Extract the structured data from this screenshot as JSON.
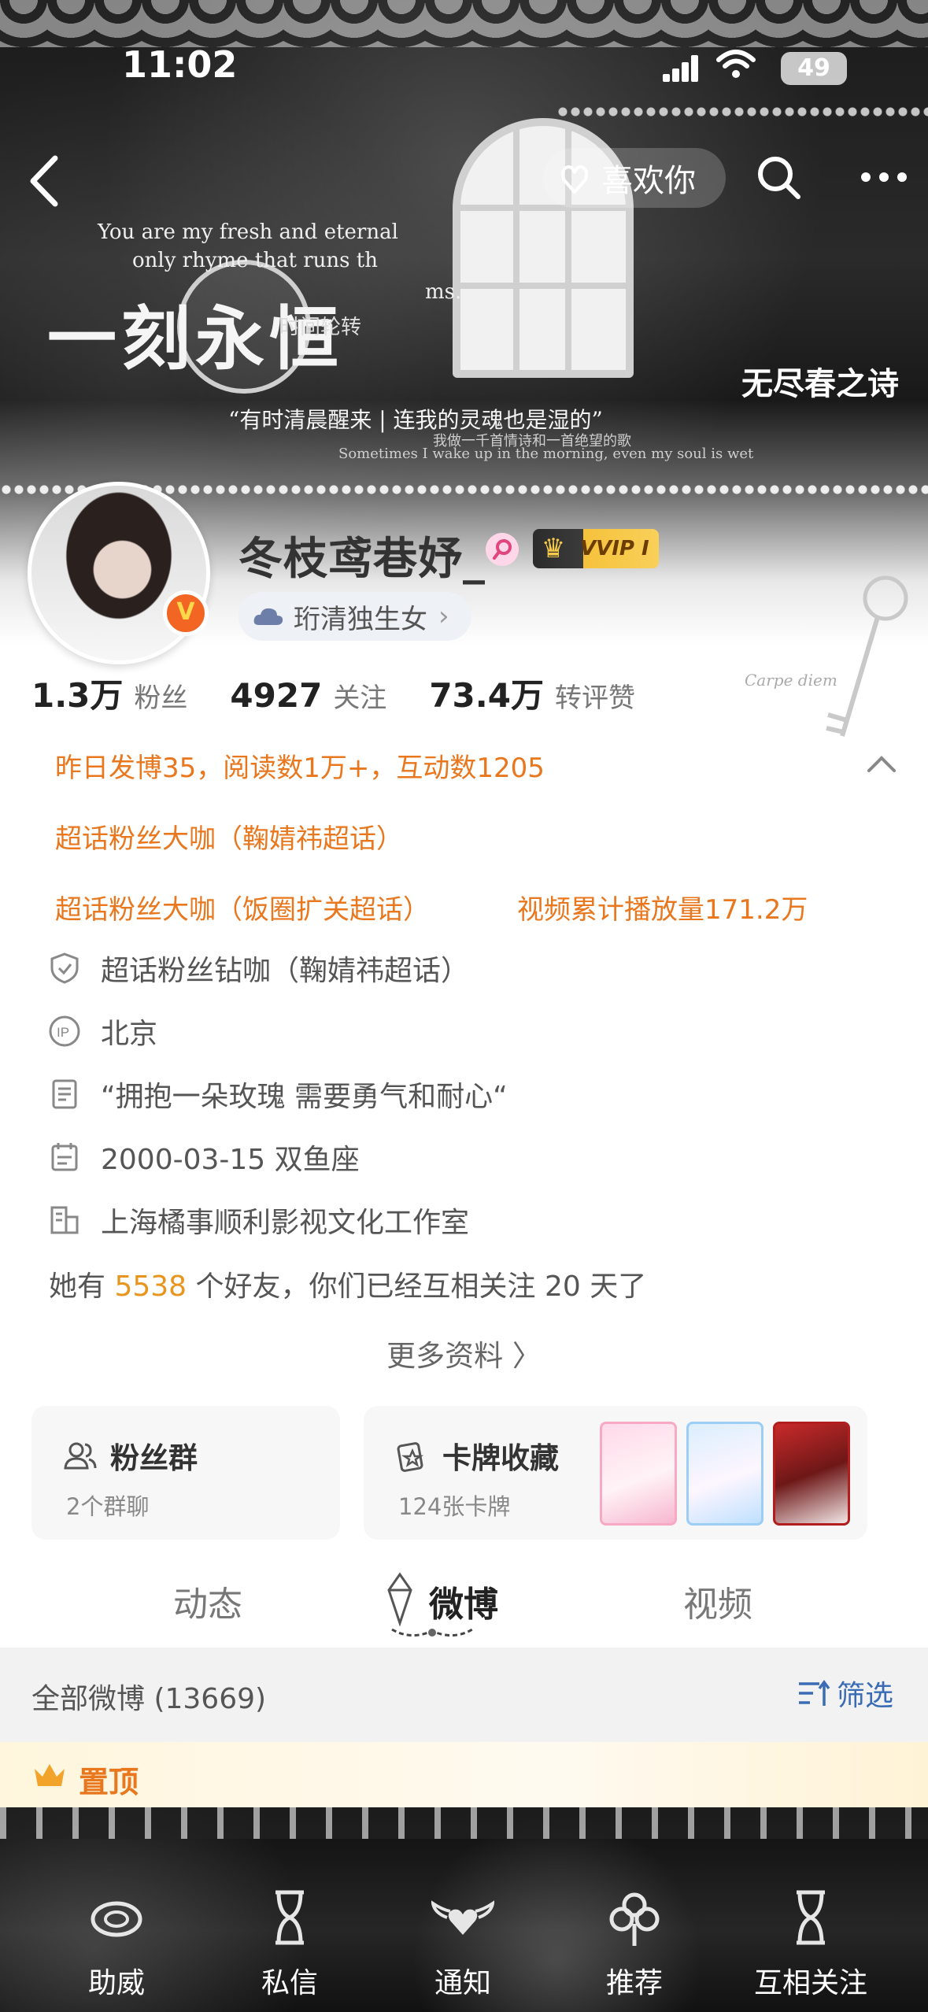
{
  "status_bar": {
    "time": "11:02",
    "battery": "49"
  },
  "nav": {
    "like_label": "喜欢你"
  },
  "banner": {
    "en_line1": "You are my fresh and eternal",
    "en_line2": "only rhyme that runs th",
    "en_line3": "ms.",
    "big_title": "一刻永恒",
    "sub_title": "时间轮转",
    "quote": "“有时清晨醒来 | 连我的灵魂也是湿的”",
    "small_cn": "我做一千首情诗和一首绝望的歌",
    "small_en": "Sometimes I wake up in the morning, even my soul is wet",
    "right_title": "无尽春之诗"
  },
  "profile": {
    "username": "冬枝鸢巷妤_",
    "vip_label": "VVIP I",
    "title_pill": "珩清独生女",
    "decor_text": "Carpe diem"
  },
  "counts": [
    {
      "num": "1.3万",
      "label": "粉丝"
    },
    {
      "num": "4927",
      "label": "关注"
    },
    {
      "num": "73.4万",
      "label": "转评赞"
    }
  ],
  "highlights": {
    "line1": "昨日发博35，阅读数1万+，互动数1205",
    "line2": "超话粉丝大咖（鞠婧祎超话）",
    "line3a": "超话粉丝大咖（饭圈扩关超话）",
    "line3b": "视频累计播放量171.2万"
  },
  "info": {
    "supertopic": "超话粉丝钻咖（鞠婧祎超话）",
    "ip_location": "北京",
    "bio": "“拥抱一朵玫瑰 需要勇气和耐心“",
    "birthday": "2000-03-15 双鱼座",
    "company": "上海橘事顺利影视文化工作室"
  },
  "friends": {
    "prefix": "她有",
    "count": "5538",
    "suffix": "个好友，你们已经互相关注 20 天了"
  },
  "more_info": "更多资料 〉",
  "cards": {
    "fans": {
      "title": "粉丝群",
      "sub": "2个群聊"
    },
    "collection": {
      "title": "卡牌收藏",
      "sub": "124张卡牌"
    }
  },
  "tabs": [
    "动态",
    "微博",
    "视频"
  ],
  "active_tab": "微博",
  "filter": {
    "title": "全部微博 (13669)",
    "button": "筛选"
  },
  "pinned": {
    "label": "置顶"
  },
  "bottom_nav": [
    "助威",
    "私信",
    "通知",
    "推荐",
    "互相关注"
  ],
  "colors": {
    "accent_orange": "#e8771e",
    "link_blue": "#3a6bb5",
    "verified": "#f26522"
  }
}
